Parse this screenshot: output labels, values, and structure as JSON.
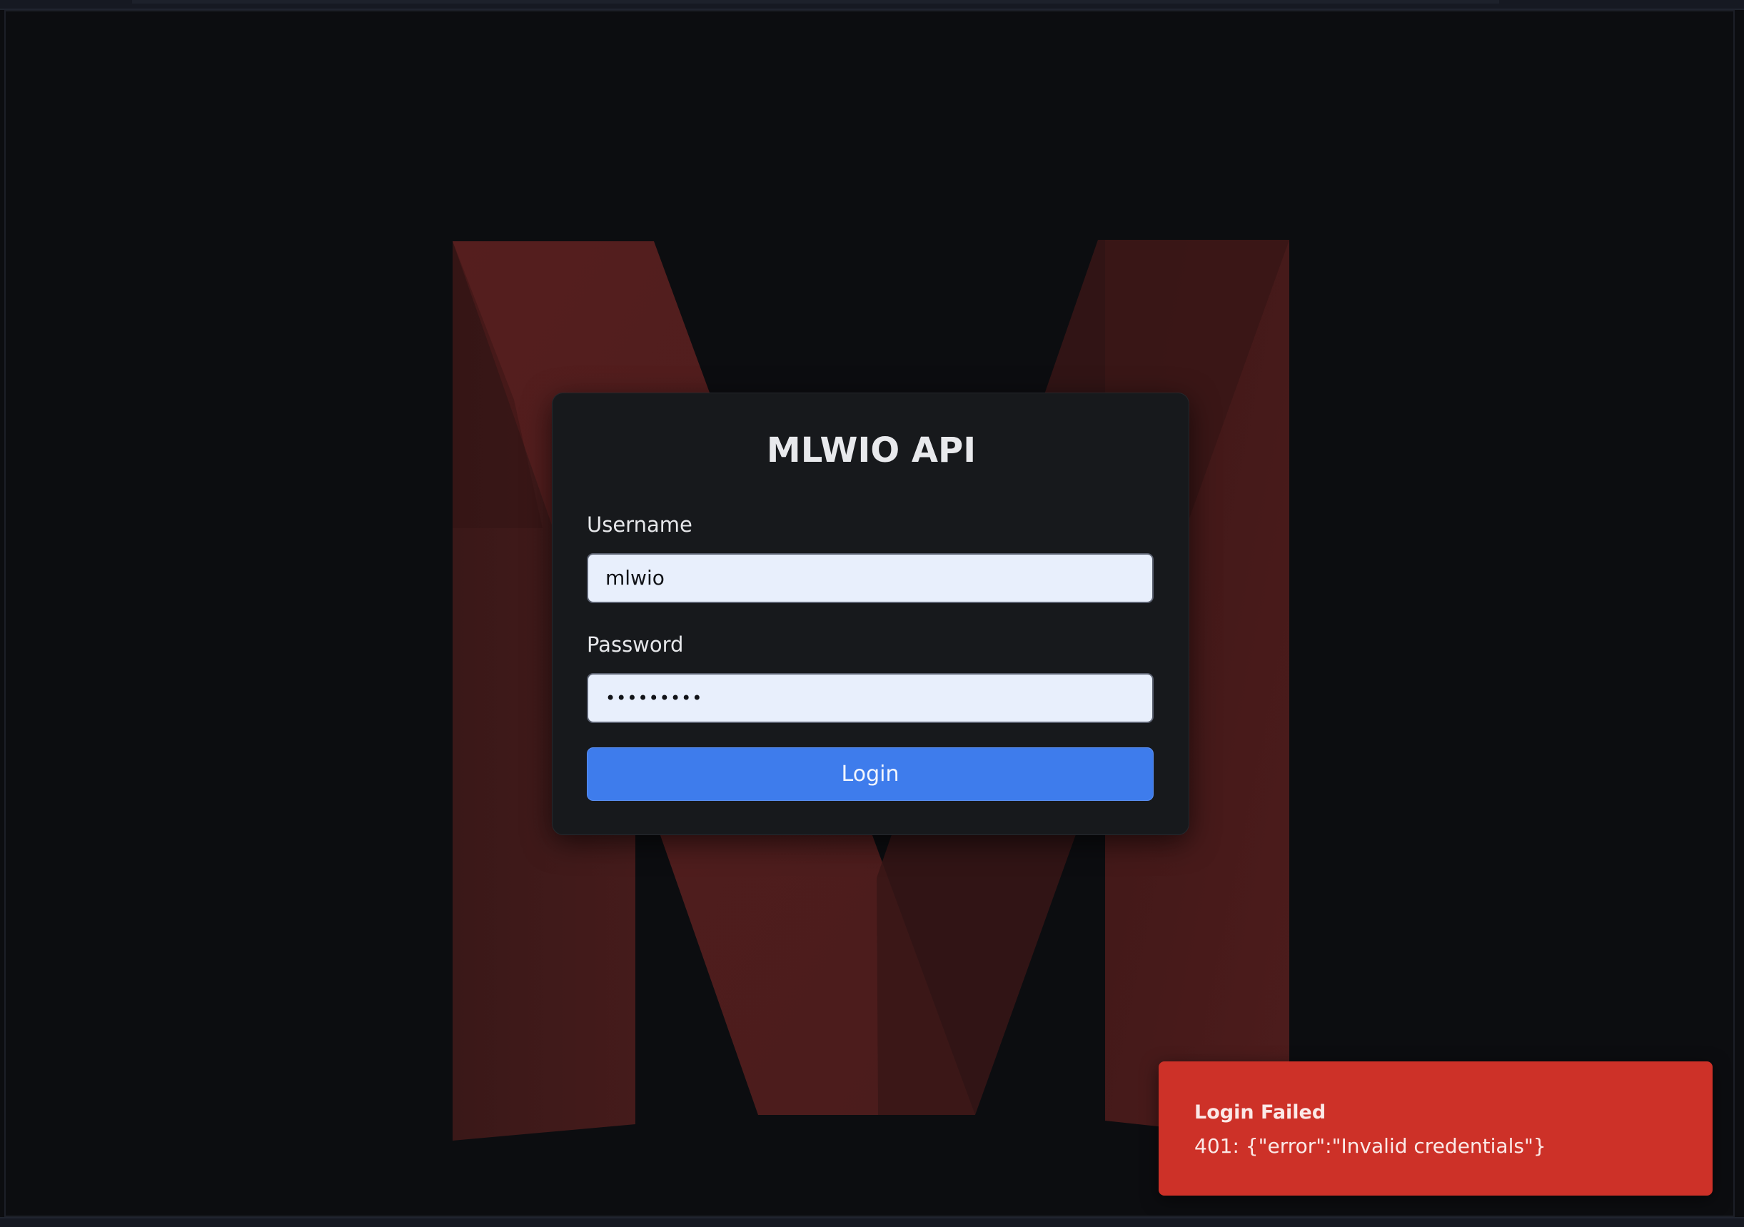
{
  "app": {
    "title": "MLWIO API"
  },
  "background": {
    "logo_icon": "netflix-style-m-logo"
  },
  "login_form": {
    "username_label": "Username",
    "username_value": "mlwio",
    "password_label": "Password",
    "password_value": "•••••••••",
    "login_button_label": "Login"
  },
  "toast": {
    "title": "Login Failed",
    "message": "401: {\"error\":\"Invalid credentials\"}",
    "color": "#cd3128"
  },
  "colors": {
    "accent": "#3e7cec",
    "background": "#0c0d10",
    "card": "#17191c",
    "logo": "#4a1c1c"
  }
}
